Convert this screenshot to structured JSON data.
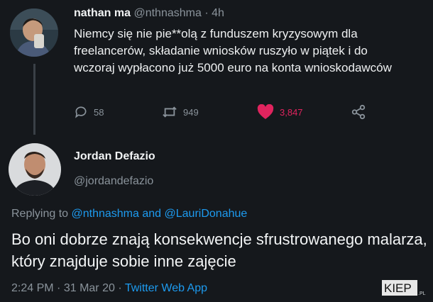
{
  "first_tweet": {
    "name": "nathan ma",
    "handle": "@nthnashma",
    "separator": "·",
    "time": "4h",
    "text": "Niemcy się nie pie**olą z funduszem kryzysowym dla freelancerów, składanie wniosków ruszyło w piątek i do wczoraj wypłacono już 5000 euro na konta wnioskodawców",
    "replies": "58",
    "retweets": "949",
    "likes": "3,847"
  },
  "second_tweet": {
    "name": "Jordan Defazio",
    "handle": "@jordandefazio",
    "replying_prefix": "Replying to",
    "replying_user_1": "@nthnashma",
    "replying_and": "and",
    "replying_user_2": "@LauriDonahue",
    "text": "Bo oni dobrze znają konsekwencje sfrustrowanego malarza, który znajduje sobie inne zajęcie",
    "time": "2:24 PM",
    "date": "31 Mar 20",
    "separator": "·",
    "source": "Twitter Web App"
  },
  "watermark": {
    "text": "KIEP",
    "suffix": ".PL"
  },
  "colors": {
    "background": "#15181c",
    "link": "#1d9bf0",
    "like": "#e0245e",
    "muted": "#8a939b"
  },
  "icons": {
    "reply": "reply-icon",
    "retweet": "retweet-icon",
    "like": "heart-icon",
    "share": "share-icon"
  }
}
